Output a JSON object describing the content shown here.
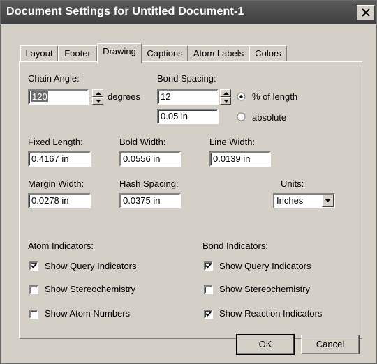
{
  "window": {
    "title": "Document Settings for Untitled Document-1"
  },
  "tabs": [
    {
      "label": "Layout",
      "active": false
    },
    {
      "label": "Footer",
      "active": false
    },
    {
      "label": "Drawing",
      "active": true
    },
    {
      "label": "Captions",
      "active": false
    },
    {
      "label": "Atom Labels",
      "active": false
    },
    {
      "label": "Colors",
      "active": false
    }
  ],
  "drawing": {
    "chain_angle": {
      "label": "Chain Angle:",
      "value": "120",
      "unit": "degrees"
    },
    "bond_spacing": {
      "label": "Bond Spacing:",
      "value": "12",
      "abs_value": "0.05 in",
      "percent_label": "% of length",
      "absolute_label": "absolute",
      "selected": "percent"
    },
    "fixed_length": {
      "label": "Fixed Length:",
      "value": "0.4167 in"
    },
    "bold_width": {
      "label": "Bold Width:",
      "value": "0.0556 in"
    },
    "line_width": {
      "label": "Line Width:",
      "value": "0.0139 in"
    },
    "margin_width": {
      "label": "Margin Width:",
      "value": "0.0278 in"
    },
    "hash_spacing": {
      "label": "Hash Spacing:",
      "value": "0.0375 in"
    },
    "units": {
      "label": "Units:",
      "value": "Inches"
    }
  },
  "atom_indicators": {
    "label": "Atom Indicators:",
    "items": [
      {
        "label": "Show Query Indicators",
        "checked": true
      },
      {
        "label": "Show Stereochemistry",
        "checked": false
      },
      {
        "label": "Show Atom Numbers",
        "checked": false
      }
    ]
  },
  "bond_indicators": {
    "label": "Bond Indicators:",
    "items": [
      {
        "label": "Show Query Indicators",
        "checked": true
      },
      {
        "label": "Show Stereochemistry",
        "checked": false
      },
      {
        "label": "Show Reaction Indicators",
        "checked": true
      }
    ]
  },
  "buttons": {
    "ok": "OK",
    "cancel": "Cancel"
  }
}
